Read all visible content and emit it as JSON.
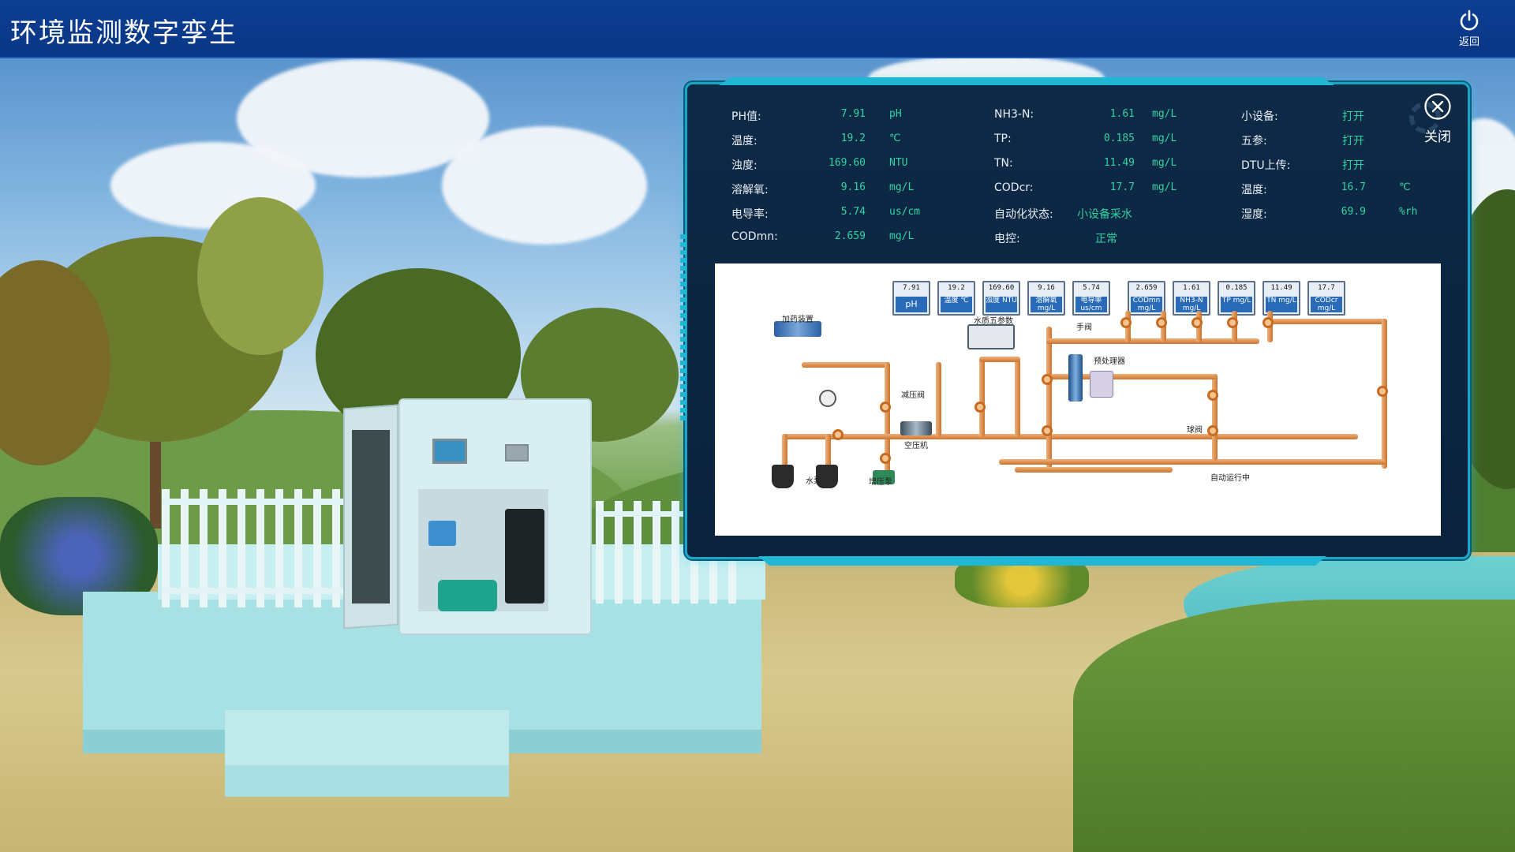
{
  "app": {
    "title": "环境监测数字孪生",
    "back_label": "返回"
  },
  "panel": {
    "close_label": "关闭",
    "col1": [
      {
        "label": "PH值:",
        "value": "7.91",
        "unit": "pH"
      },
      {
        "label": "温度:",
        "value": "19.2",
        "unit": "℃"
      },
      {
        "label": "浊度:",
        "value": "169.60",
        "unit": "NTU"
      },
      {
        "label": "溶解氧:",
        "value": "9.16",
        "unit": "mg/L"
      },
      {
        "label": "电导率:",
        "value": "5.74",
        "unit": "us/cm"
      },
      {
        "label": "CODmn:",
        "value": "2.659",
        "unit": "mg/L"
      }
    ],
    "col2": [
      {
        "label": "NH3-N:",
        "value": "1.61",
        "unit": "mg/L"
      },
      {
        "label": "TP:",
        "value": "0.185",
        "unit": "mg/L"
      },
      {
        "label": "TN:",
        "value": "11.49",
        "unit": "mg/L"
      },
      {
        "label": "CODcr:",
        "value": "17.7",
        "unit": "mg/L"
      },
      {
        "label": "自动化状态:",
        "value": "小设备采水",
        "unit": ""
      },
      {
        "label": "电控:",
        "value": "正常",
        "unit": ""
      }
    ],
    "col3": [
      {
        "label": "小设备:",
        "value": "打开",
        "unit": ""
      },
      {
        "label": "五参:",
        "value": "打开",
        "unit": ""
      },
      {
        "label": "DTU上传:",
        "value": "打开",
        "unit": ""
      },
      {
        "label": "温度:",
        "value": "16.7",
        "unit": "℃"
      },
      {
        "label": "湿度:",
        "value": "69.9",
        "unit": "%rh"
      }
    ]
  },
  "diagram": {
    "sensors_left": [
      {
        "value": "7.91",
        "name": "pH"
      },
      {
        "value": "19.2",
        "name": "温度 ℃"
      },
      {
        "value": "169.60",
        "name": "浊度 NTU"
      },
      {
        "value": "9.16",
        "name": "溶解氧 mg/L"
      },
      {
        "value": "5.74",
        "name": "电导率 us/cm"
      }
    ],
    "sensors_right": [
      {
        "value": "2.659",
        "name": "CODmn mg/L"
      },
      {
        "value": "1.61",
        "name": "NH3-N mg/L"
      },
      {
        "value": "0.185",
        "name": "TP mg/L"
      },
      {
        "value": "11.49",
        "name": "TN mg/L"
      },
      {
        "value": "17.7",
        "name": "CODcr mg/L"
      }
    ],
    "labels": {
      "dosing": "加药装置",
      "five_param": "水质五参数",
      "hand_valve": "手阀",
      "pretreatment": "预处理器",
      "pressure_relief": "减压阀",
      "air_compressor": "空压机",
      "water_pump": "水泵",
      "booster_pump": "增压泵",
      "ball_valve": "球阀",
      "status": "自动运行中"
    }
  }
}
